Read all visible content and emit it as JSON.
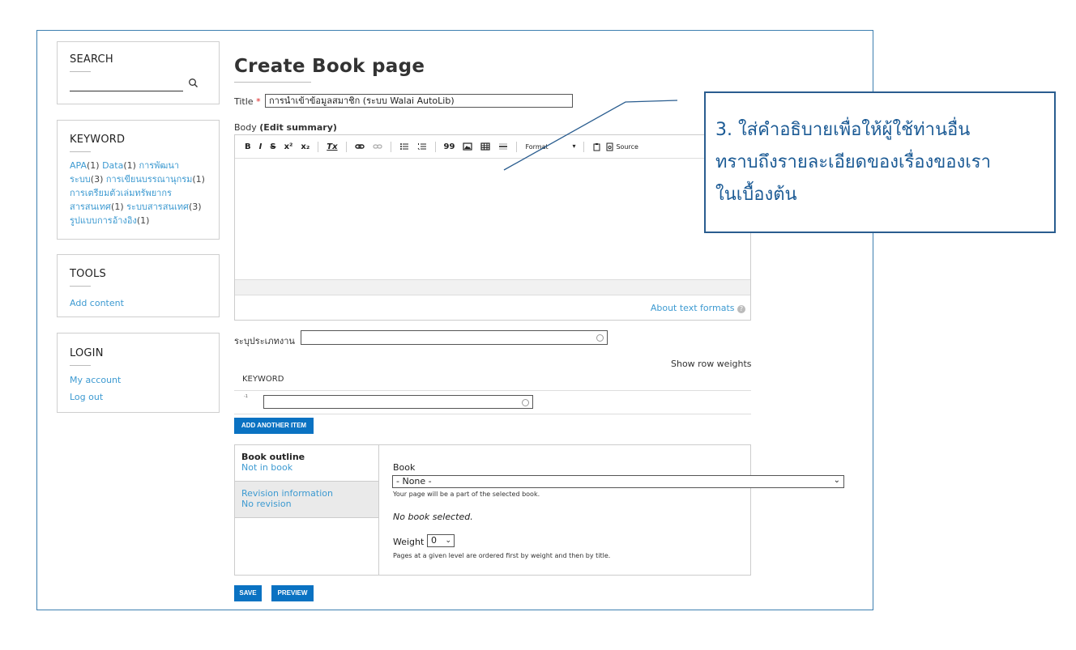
{
  "sidebar": {
    "search": {
      "title": "SEARCH"
    },
    "keyword": {
      "title": "KEYWORD",
      "items": [
        {
          "label": "APA",
          "count": "(1)"
        },
        {
          "label": "Data",
          "count": "(1)"
        },
        {
          "label": "การพัฒนาระบบ",
          "count": "(3)"
        },
        {
          "label": "การเขียนบรรณานุกรม",
          "count": "(1)"
        },
        {
          "label": "การเตรียมตัวเล่มทรัพยากรสารสนเทศ",
          "count": "(1)"
        },
        {
          "label": "ระบบสารสนเทศ",
          "count": "(3)"
        },
        {
          "label": "รูปแบบการอ้างอิง",
          "count": "(1)"
        }
      ]
    },
    "tools": {
      "title": "TOOLS",
      "add_content": "Add content"
    },
    "login": {
      "title": "LOGIN",
      "my_account": "My account",
      "log_out": "Log out"
    }
  },
  "page": {
    "heading": "Create Book page",
    "title_label": "Title",
    "required_mark": "*",
    "title_value": "การนำเข้าข้อมูลสมาชิก (ระบบ Walai AutoLib)",
    "body_label": "Body",
    "edit_summary": "(Edit summary)",
    "toolbar": {
      "bold": "B",
      "italic": "I",
      "strike": "S",
      "superscript": "x²",
      "subscript": "x₂",
      "remove_format": "Tx",
      "quote": "99",
      "format": "Format",
      "source": "Source"
    },
    "about_formats": "About text formats",
    "work_type_label": "ระบุประเภทงาน",
    "show_row_weights": "Show row weights",
    "keyword_column": "KEYWORD",
    "row_marker": "-1",
    "add_another": "ADD ANOTHER ITEM",
    "book_outline": {
      "tab1_title": "Book outline",
      "tab1_sub": "Not in book",
      "tab2_title": "Revision information",
      "tab2_sub": "No revision",
      "book_label": "Book",
      "book_selected": "- None -",
      "book_help": "Your page will be a part of the selected book.",
      "no_book": "No book selected.",
      "weight_label": "Weight",
      "weight_value": "0",
      "weight_help": "Pages at a given level are ordered first by weight and then by title."
    },
    "save": "SAVE",
    "preview": "PREVIEW"
  },
  "callout": {
    "line1": "3. ใส่คำอธิบายเพื่อให้ผู้ใช้ท่านอื่น",
    "line2": "ทราบถึงรายละเอียดของเรื่องของเรา",
    "line3": "ในเบื้องต้น",
    "border_color": "#2a5d8f",
    "text_color": "#1c5b95"
  }
}
